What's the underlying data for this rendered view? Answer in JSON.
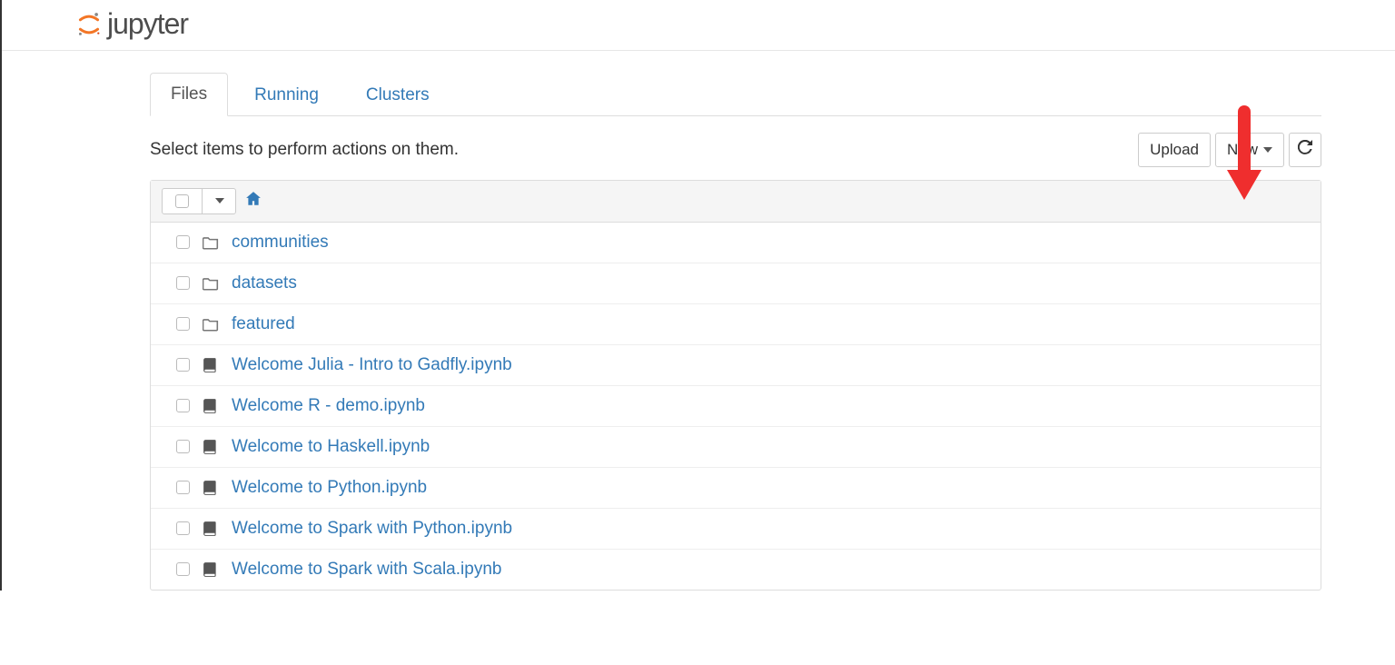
{
  "app_name": "jupyter",
  "tabs": [
    {
      "label": "Files",
      "active": true
    },
    {
      "label": "Running",
      "active": false
    },
    {
      "label": "Clusters",
      "active": false
    }
  ],
  "helper_text": "Select items to perform actions on them.",
  "buttons": {
    "upload": "Upload",
    "new": "New"
  },
  "items": [
    {
      "type": "folder",
      "name": "communities"
    },
    {
      "type": "folder",
      "name": "datasets"
    },
    {
      "type": "folder",
      "name": "featured"
    },
    {
      "type": "notebook",
      "name": "Welcome Julia - Intro to Gadfly.ipynb"
    },
    {
      "type": "notebook",
      "name": "Welcome R - demo.ipynb"
    },
    {
      "type": "notebook",
      "name": "Welcome to Haskell.ipynb"
    },
    {
      "type": "notebook",
      "name": "Welcome to Python.ipynb"
    },
    {
      "type": "notebook",
      "name": "Welcome to Spark with Python.ipynb"
    },
    {
      "type": "notebook",
      "name": "Welcome to Spark with Scala.ipynb"
    }
  ]
}
